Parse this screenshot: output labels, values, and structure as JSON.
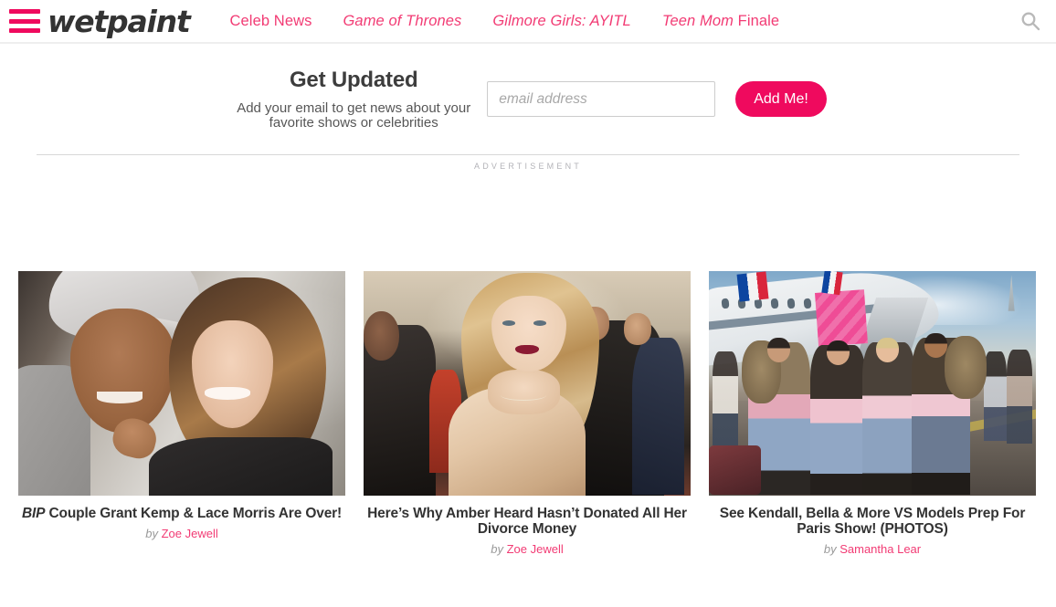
{
  "header": {
    "brand": "wetpaint",
    "menu_icon": "hamburger-menu-icon",
    "search_icon": "search-icon",
    "nav": [
      {
        "label": "Celeb News",
        "italic": false,
        "show": "",
        "suffix": ""
      },
      {
        "label": "Game of Thrones",
        "italic": true,
        "show": "",
        "suffix": ""
      },
      {
        "label": "Gilmore Girls: AYITL",
        "italic": true,
        "show": "",
        "suffix": ""
      },
      {
        "label": "",
        "italic": false,
        "show": "Teen Mom",
        "suffix": " Finale"
      }
    ]
  },
  "newsletter": {
    "title": "Get Updated",
    "subtitle": "Add your email to get news about your favorite shows or celebrities",
    "email_placeholder": "email address",
    "email_value": "",
    "submit_label": "Add Me!"
  },
  "advertisement": {
    "label": "ADVERTISEMENT"
  },
  "cards": [
    {
      "image_alt": "couple-selfie-photo",
      "title_show": "BIP",
      "title_rest": " Couple Grant Kemp & Lace Morris Are Over!",
      "by_label": "by",
      "author": "Zoe Jewell"
    },
    {
      "image_alt": "amber-heard-red-carpet-photo",
      "title_show": "",
      "title_rest": "Here’s Why Amber Heard Hasn’t Donated All Her Divorce Money",
      "by_label": "by",
      "author": "Zoe Jewell"
    },
    {
      "image_alt": "vs-models-airport-photo",
      "title_show": "",
      "title_rest": "See Kendall, Bella & More VS Models Prep For Paris Show! (PHOTOS)",
      "by_label": "by",
      "author": "Samantha Lear"
    }
  ],
  "colors": {
    "brand_pink": "#ef0a5e",
    "nav_pink": "#f23b74",
    "logo_dark": "#333333",
    "ad_label_grey": "#b3b3b8",
    "byline_grey": "#999999"
  }
}
